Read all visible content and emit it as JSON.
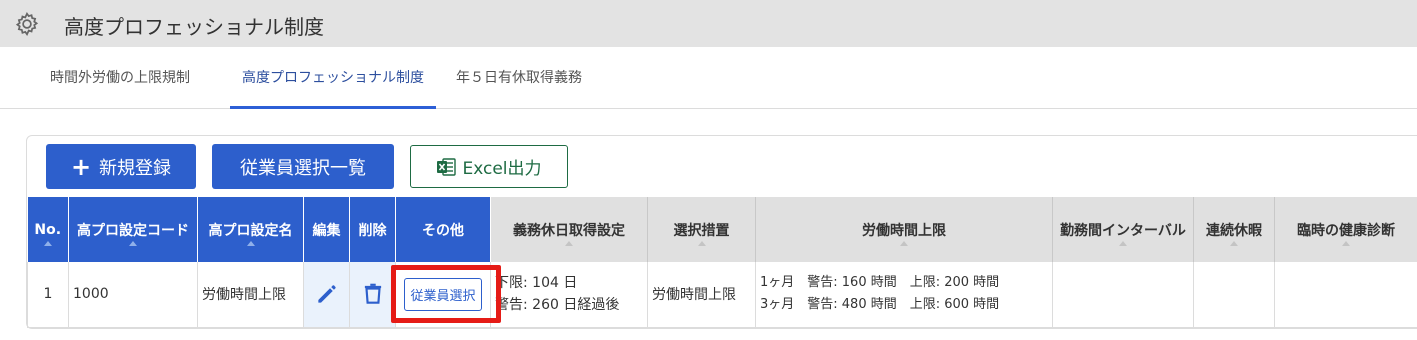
{
  "header": {
    "title": "高度プロフェッショナル制度",
    "icon": "gear-icon"
  },
  "tabs": [
    {
      "label": "時間外労働の上限規制",
      "active": false
    },
    {
      "label": "高度プロフェッショナル制度",
      "active": true
    },
    {
      "label": "年５日有休取得義務",
      "active": false
    }
  ],
  "toolbar": {
    "new_label": "新規登録",
    "employee_list_label": "従業員選択一覧",
    "excel_label": "Excel出力"
  },
  "table": {
    "columns": [
      "No.",
      "高プロ設定コード",
      "高プロ設定名",
      "編集",
      "削除",
      "その他",
      "義務休日取得設定",
      "選択措置",
      "労働時間上限",
      "勤務間インターバル",
      "連続休暇",
      "臨時の健康診断"
    ],
    "rows": [
      {
        "no": "1",
        "code": "1000",
        "name": "労働時間上限",
        "other_button": "従業員選択",
        "holiday_line1": "下限: 104 日",
        "holiday_line2": "警告: 260 日経過後",
        "measure": "労働時間上限",
        "limit_line1": "1ヶ月　警告: 160 時間　上限: 200 時間",
        "limit_line2": "3ヶ月　警告: 480 時間　上限: 600 時間",
        "interval": "",
        "vacation": "",
        "health_check": ""
      }
    ]
  },
  "colors": {
    "primary": "#2d5fcc",
    "header_gray": "#e0e0e0",
    "titlebar": "#e3e3e3",
    "excel_green": "#1e6b43",
    "highlight_red": "#e51b16"
  }
}
